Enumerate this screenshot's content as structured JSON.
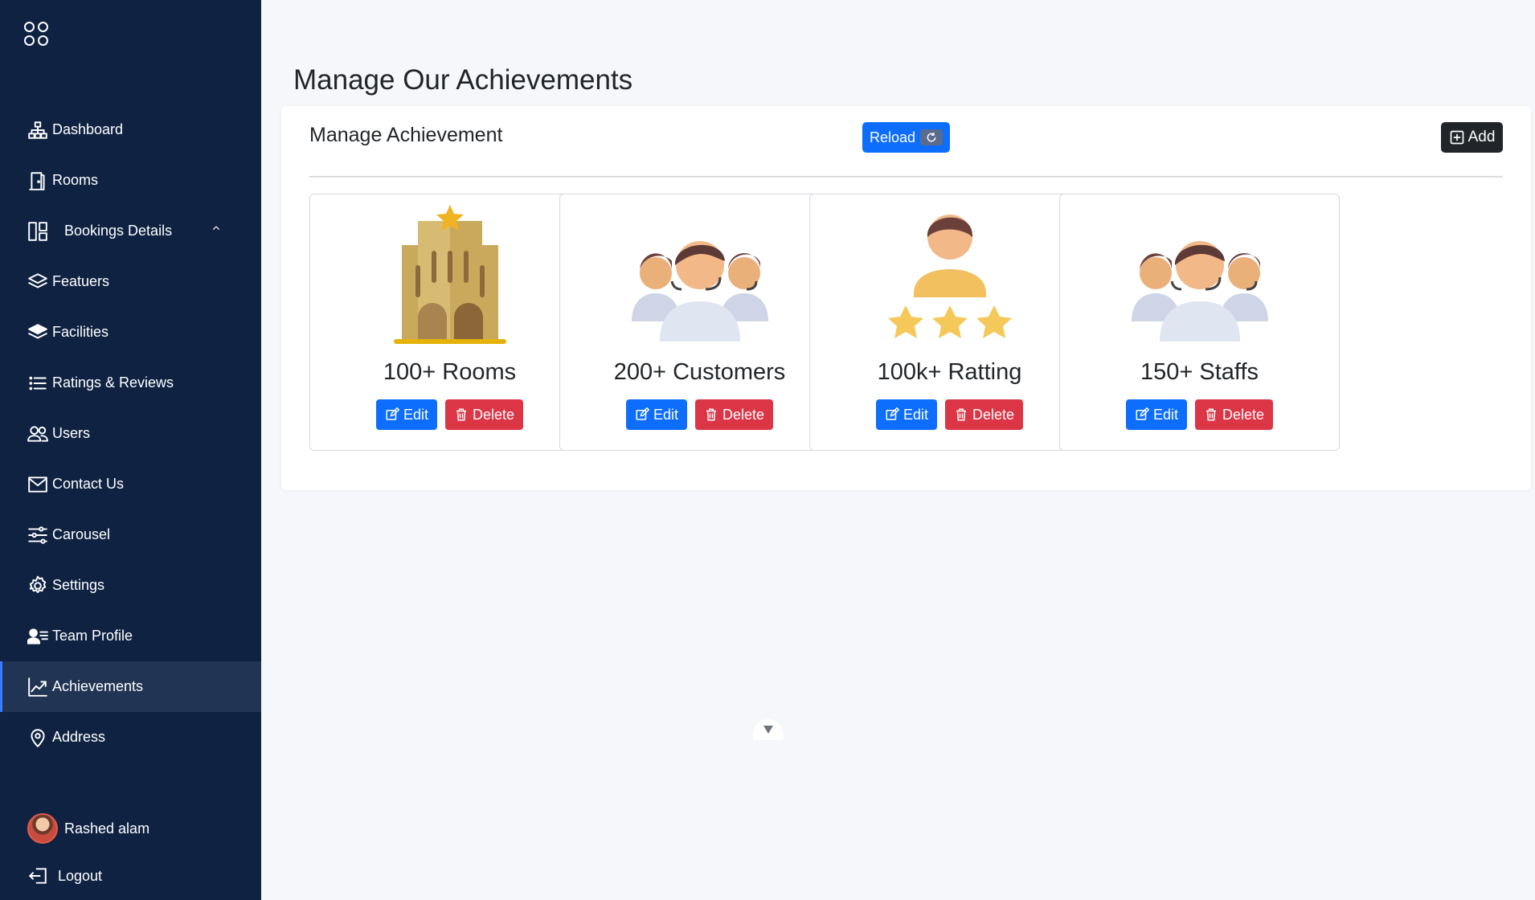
{
  "sidebar": {
    "items": [
      {
        "label": "Dashboard",
        "icon": "sitemap-icon"
      },
      {
        "label": "Rooms",
        "icon": "door-icon"
      },
      {
        "label": "Bookings Details",
        "icon": "layout-icon"
      },
      {
        "label": "Featuers",
        "icon": "layers-icon"
      },
      {
        "label": "Facilities",
        "icon": "layers-fill-icon"
      },
      {
        "label": "Ratings & Reviews",
        "icon": "list-icon"
      },
      {
        "label": "Users",
        "icon": "users-icon"
      },
      {
        "label": "Contact Us",
        "icon": "envelope-icon"
      },
      {
        "label": "Carousel",
        "icon": "sliders-icon"
      },
      {
        "label": "Settings",
        "icon": "gear-icon"
      },
      {
        "label": "Team Profile",
        "icon": "person-lines-icon"
      },
      {
        "label": "Achievements",
        "icon": "graph-up-icon"
      },
      {
        "label": "Address",
        "icon": "geo-pin-icon"
      }
    ],
    "active": "Achievements",
    "user": {
      "name": "Rashed alam"
    },
    "logout_label": "Logout"
  },
  "main": {
    "page_title": "Manage Our Achievements",
    "panel_title": "Manage Achievement",
    "reload_label": "Reload",
    "add_label": "Add",
    "cards": [
      {
        "label": "100+ Rooms",
        "image": "hotel-building-icon",
        "edit_label": "Edit",
        "delete_label": "Delete"
      },
      {
        "label": "200+ Customers",
        "image": "customer-support-group-icon",
        "edit_label": "Edit",
        "delete_label": "Delete"
      },
      {
        "label": "100k+ Ratting",
        "image": "person-three-stars-icon",
        "edit_label": "Edit",
        "delete_label": "Delete"
      },
      {
        "label": "150+ Staffs",
        "image": "staff-group-icon",
        "edit_label": "Edit",
        "delete_label": "Delete"
      }
    ]
  },
  "colors": {
    "sidebar_bg": "#0f2242",
    "active_bg": "#213453",
    "primary": "#0d6efd",
    "danger": "#dc3545",
    "dark": "#212529"
  }
}
